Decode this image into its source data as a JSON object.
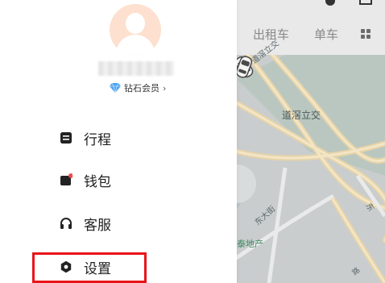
{
  "topbar": {
    "tabs": [
      "出租车",
      "单车"
    ]
  },
  "map": {
    "labels": {
      "interchange_1": "道滘立交",
      "interchange_2": "道滘立交",
      "street": "东大街",
      "estate": "泰地产",
      "east_road": "东",
      "bottom_road": "路"
    }
  },
  "drawer": {
    "membership_label": "钻石会员",
    "membership_chevron": "›",
    "menu": [
      {
        "label": "行程",
        "icon": "itinerary-icon"
      },
      {
        "label": "钱包",
        "icon": "wallet-icon",
        "badge": true
      },
      {
        "label": "客服",
        "icon": "headset-icon"
      },
      {
        "label": "设置",
        "icon": "gear-icon"
      }
    ]
  },
  "colors": {
    "highlight": "#e8141a",
    "wallet_badge": "#f04b4b",
    "avatar_bg": "#fde0cf",
    "diamond": "#4aa3f0"
  }
}
